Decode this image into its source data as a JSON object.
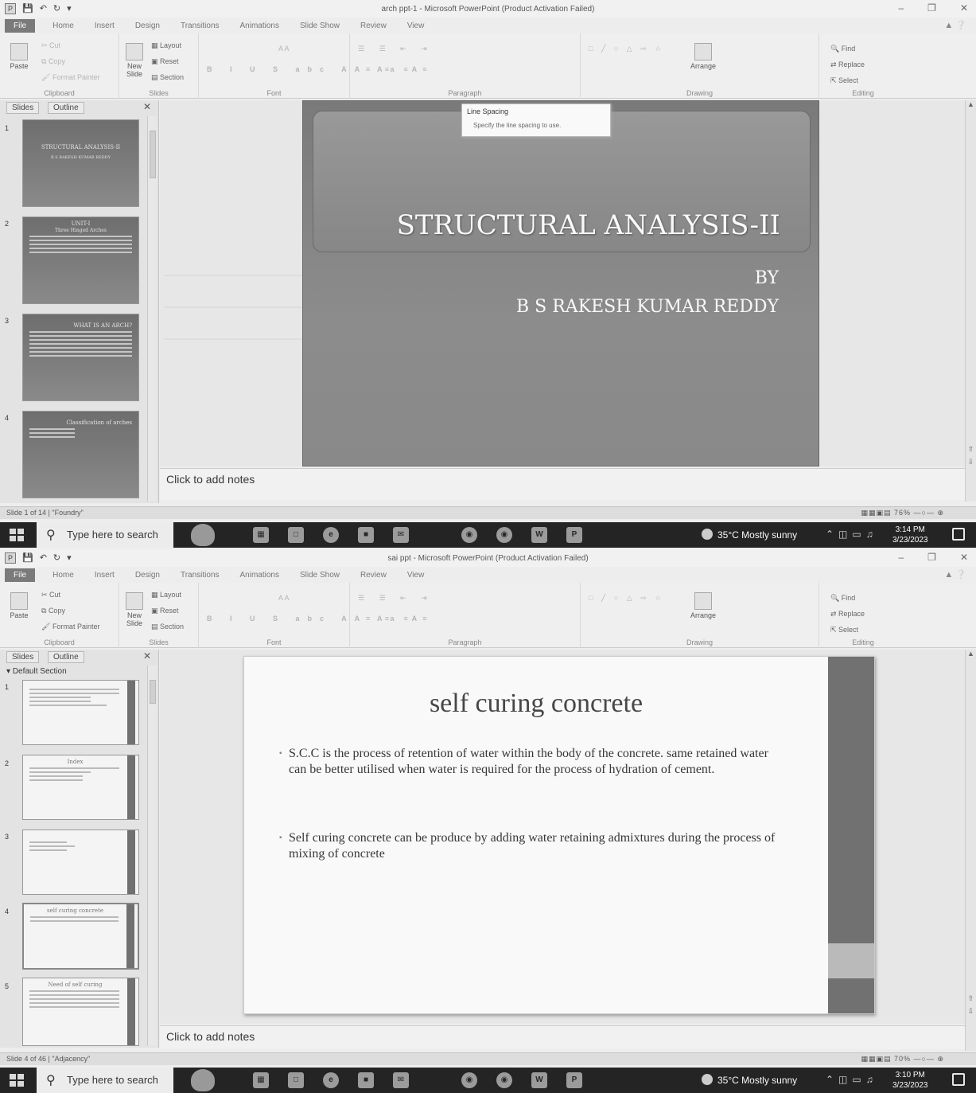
{
  "screen1": {
    "title": "arch ppt-1 - Microsoft PowerPoint (Product Activation Failed)",
    "tabs": [
      "File",
      "Home",
      "Insert",
      "Design",
      "Transitions",
      "Animations",
      "Slide Show",
      "Review",
      "View"
    ],
    "ribbon": {
      "paste": "Paste",
      "cut": "Cut",
      "copy": "Copy",
      "format_painter": "Format Painter",
      "clipboard": "Clipboard",
      "new_slide": "New Slide",
      "layout": "Layout",
      "reset": "Reset",
      "section": "Section",
      "slides": "Slides",
      "font": "Font",
      "paragraph": "Paragraph",
      "drawing": "Drawing",
      "arrange": "Arrange",
      "find": "Find",
      "replace": "Replace",
      "select": "Select",
      "editing": "Editing"
    },
    "tooltip": {
      "title": "Line Spacing",
      "desc": "Specify the line spacing to use."
    },
    "pane_tabs": [
      "Slides",
      "Outline"
    ],
    "thumbs": [
      {
        "num": "1",
        "title": "STRUCTURAL ANALYSIS-II",
        "sub": "B S RAKESH KUMAR REDDY"
      },
      {
        "num": "2",
        "title": "UNIT-I",
        "sub": "Three Hinged Arches"
      },
      {
        "num": "3",
        "title": "WHAT IS AN ARCH?",
        "sub": ""
      },
      {
        "num": "4",
        "title": "Classification of arches",
        "sub": ""
      }
    ],
    "slide": {
      "title": "STRUCTURAL ANALYSIS-II",
      "by": "BY",
      "author": "B S RAKESH KUMAR REDDY"
    },
    "notes": "Click to add notes",
    "status_left": "Slide 1 of 14 | \"Foundry\"",
    "status_zoom": "76%",
    "taskbar": {
      "search": "Type here to search",
      "weather": "35°C  Mostly sunny",
      "time": "3:14 PM",
      "date": "3/23/2023"
    }
  },
  "screen2": {
    "title": "sai ppt - Microsoft PowerPoint (Product Activation Failed)",
    "tabs": [
      "File",
      "Home",
      "Insert",
      "Design",
      "Transitions",
      "Animations",
      "Slide Show",
      "Review",
      "View"
    ],
    "ribbon": {
      "paste": "Paste",
      "cut": "Cut",
      "copy": "Copy",
      "format_painter": "Format Painter",
      "clipboard": "Clipboard",
      "new_slide": "New Slide",
      "layout": "Layout",
      "reset": "Reset",
      "section": "Section",
      "slides": "Slides",
      "font": "Font",
      "paragraph": "Paragraph",
      "drawing": "Drawing",
      "arrange": "Arrange",
      "find": "Find",
      "replace": "Replace",
      "select": "Select",
      "editing": "Editing"
    },
    "pane_tabs": [
      "Slides",
      "Outline"
    ],
    "section_header": "Default Section",
    "thumbs": [
      {
        "num": "1",
        "title": ""
      },
      {
        "num": "2",
        "title": "Index"
      },
      {
        "num": "3",
        "title": ""
      },
      {
        "num": "4",
        "title": "self curing concrete"
      },
      {
        "num": "5",
        "title": "Need of self curing"
      }
    ],
    "slide": {
      "title": "self curing concrete",
      "bullets": [
        "S.C.C is the process of retention of water within the body of the concrete. same retained water can be better utilised when water is required for the process of hydration of cement.",
        "Self curing concrete can be produce by adding water retaining admixtures during the process of mixing of concrete"
      ]
    },
    "notes": "Click to add notes",
    "status_left": "Slide 4 of 46 | \"Adjacency\"",
    "status_zoom": "70%",
    "taskbar": {
      "search": "Type here to search",
      "weather": "35°C  Mostly sunny",
      "time": "3:10 PM",
      "date": "3/23/2023"
    }
  }
}
